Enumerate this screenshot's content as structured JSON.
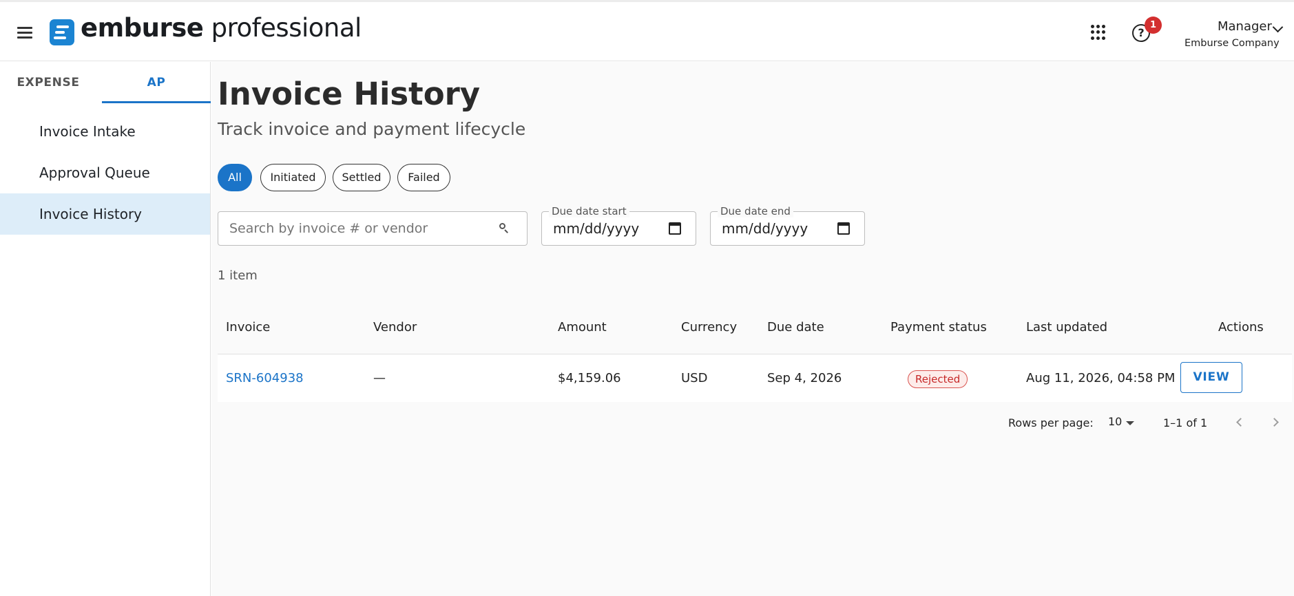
{
  "app": {
    "brand_bold": "emburse",
    "brand_light": " professional"
  },
  "header": {
    "notification_count": "1",
    "user_name": "Manager",
    "user_company": "Emburse Company"
  },
  "sidebar": {
    "tabs": [
      {
        "label": "EXPENSE"
      },
      {
        "label": "AP"
      }
    ],
    "items": [
      {
        "label": "Invoice Intake"
      },
      {
        "label": "Approval Queue"
      },
      {
        "label": "Invoice History"
      }
    ]
  },
  "page": {
    "title": "Invoice History",
    "subtitle": "Track invoice and payment lifecycle"
  },
  "filters": {
    "chips": [
      {
        "label": "All"
      },
      {
        "label": "Initiated"
      },
      {
        "label": "Settled"
      },
      {
        "label": "Failed"
      }
    ],
    "search_placeholder": "Search by invoice # or vendor",
    "due_start_label": "Due date start",
    "due_end_label": "Due date end",
    "date_placeholder": "mm/dd/yyyy"
  },
  "table": {
    "item_count": "1 item",
    "columns": [
      "Invoice",
      "Vendor",
      "Amount",
      "Currency",
      "Due date",
      "Payment status",
      "Last updated",
      "Actions"
    ],
    "rows": [
      {
        "invoice": "SRN-604938",
        "vendor": "—",
        "amount": "$4,159.06",
        "currency": "USD",
        "due_date": "Sep 4, 2026",
        "status": "Rejected",
        "last_updated": "Aug 11, 2026, 04:58 PM",
        "action": "VIEW"
      }
    ]
  },
  "pagination": {
    "rows_per_page_label": "Rows per page:",
    "rows_per_page": "10",
    "range": "1–1 of 1"
  },
  "colors": {
    "accent": "#1b74c8",
    "active_nav": "#ddedf9",
    "status_rejected": "#c62828",
    "badge": "#d32f2f"
  },
  "icons": [
    "menu-icon",
    "emburse-logo-icon",
    "apps-grid-icon",
    "help-icon",
    "chevron-down-icon",
    "search-icon",
    "calendar-icon",
    "chevron-left-icon",
    "chevron-right-icon"
  ]
}
